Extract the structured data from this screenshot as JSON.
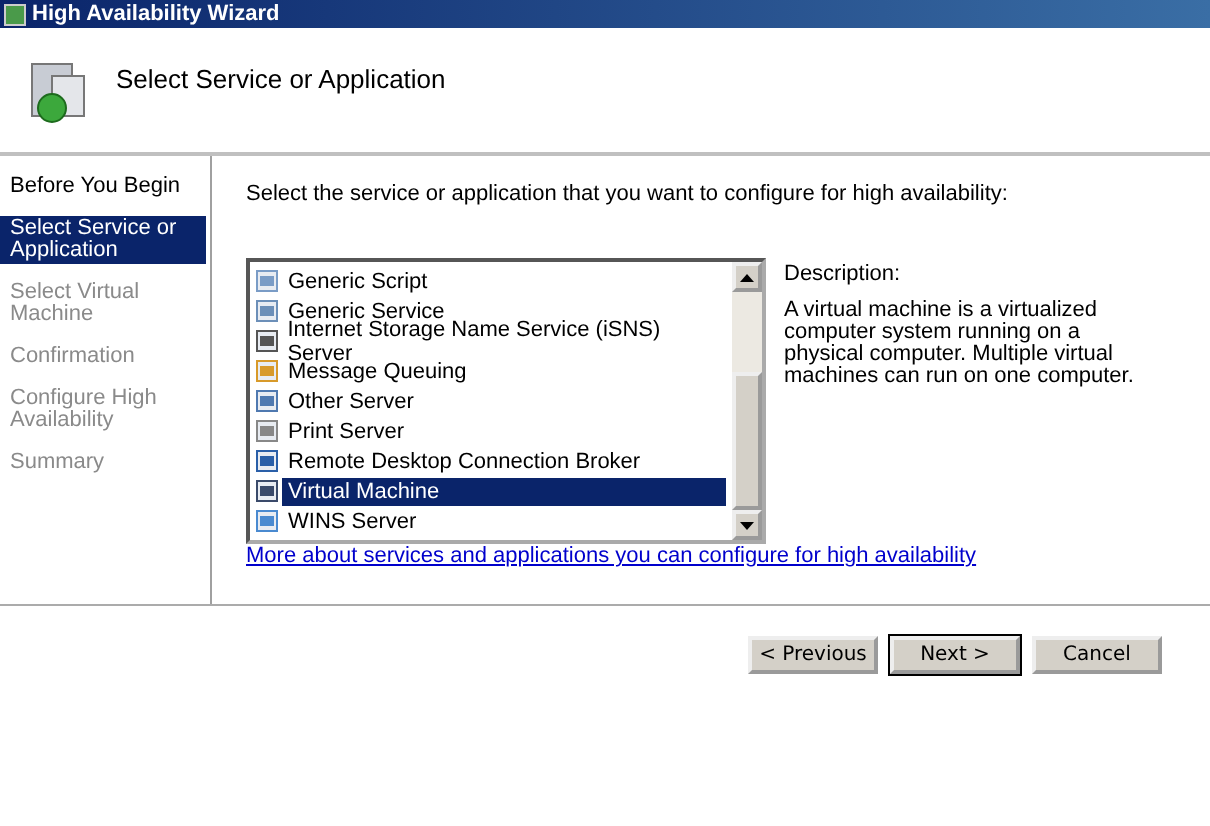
{
  "window": {
    "title": "High Availability Wizard"
  },
  "header": {
    "title": "Select Service or Application"
  },
  "steps": [
    {
      "label": "Before You Begin",
      "selected": false,
      "disabled": false
    },
    {
      "label": "Select Service or Application",
      "selected": true,
      "disabled": false
    },
    {
      "label": "Select Virtual Machine",
      "selected": false,
      "disabled": true
    },
    {
      "label": "Confirmation",
      "selected": false,
      "disabled": true
    },
    {
      "label": "Configure High Availability",
      "selected": false,
      "disabled": true
    },
    {
      "label": "Summary",
      "selected": false,
      "disabled": true
    }
  ],
  "instruction": "Select the service or application that you want to configure for high availability:",
  "services": [
    {
      "label": "Generic Script",
      "selected": false
    },
    {
      "label": "Generic Service",
      "selected": false
    },
    {
      "label": "Internet Storage Name Service (iSNS) Server",
      "selected": false
    },
    {
      "label": "Message Queuing",
      "selected": false
    },
    {
      "label": "Other Server",
      "selected": false
    },
    {
      "label": "Print Server",
      "selected": false
    },
    {
      "label": "Remote Desktop Connection Broker",
      "selected": false
    },
    {
      "label": "Virtual Machine",
      "selected": true
    },
    {
      "label": "WINS Server",
      "selected": false
    }
  ],
  "description": {
    "label": "Description:",
    "text": "A virtual machine is a virtualized computer system running on a physical computer. Multiple virtual machines can run on one computer."
  },
  "link": "More about services and applications you can configure for high availability",
  "buttons": [
    {
      "label": "< Previous",
      "default": false
    },
    {
      "label": "Next >",
      "default": true
    },
    {
      "label": "Cancel",
      "default": false
    }
  ]
}
